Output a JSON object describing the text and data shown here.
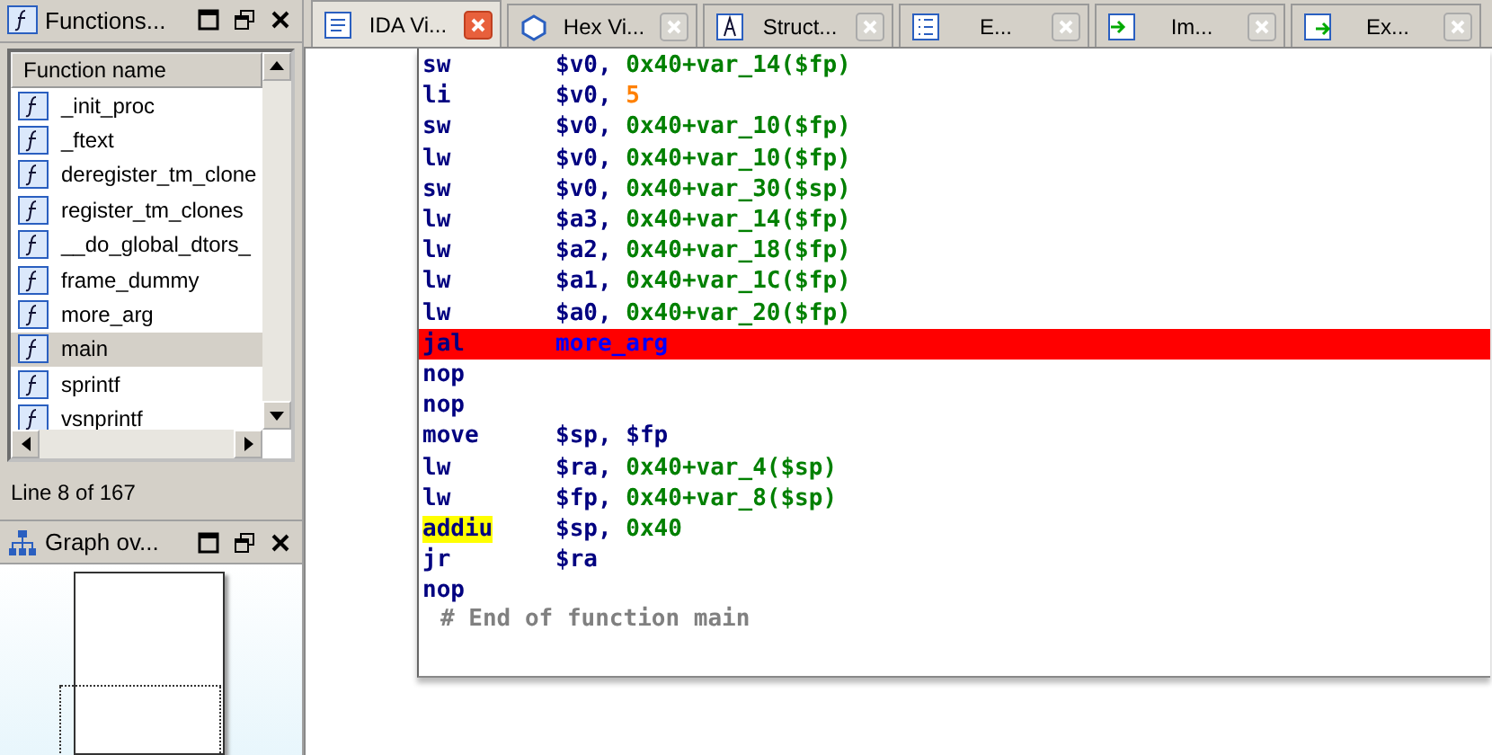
{
  "functions_panel": {
    "title": "Functions...",
    "column": "Function name",
    "items": [
      {
        "name": "_init_proc",
        "selected": false
      },
      {
        "name": "_ftext",
        "selected": false
      },
      {
        "name": "deregister_tm_clone",
        "selected": false
      },
      {
        "name": "register_tm_clones",
        "selected": false
      },
      {
        "name": "__do_global_dtors_",
        "selected": false
      },
      {
        "name": "frame_dummy",
        "selected": false
      },
      {
        "name": "more_arg",
        "selected": false
      },
      {
        "name": "main",
        "selected": true
      },
      {
        "name": "sprintf",
        "selected": false
      },
      {
        "name": "vsnprintf",
        "selected": false
      }
    ],
    "status": "Line 8 of 167"
  },
  "graph_panel": {
    "title": "Graph ov..."
  },
  "tabs": [
    {
      "label": "IDA Vi...",
      "selected": true
    },
    {
      "label": "Hex Vi...",
      "selected": false
    },
    {
      "label": "Struct...",
      "selected": false
    },
    {
      "label": "E...",
      "selected": false
    },
    {
      "label": "Im...",
      "selected": false
    },
    {
      "label": "Ex...",
      "selected": false
    }
  ],
  "listing": {
    "lines": [
      {
        "mnemonic": "sw",
        "selected": false,
        "highlighted": false,
        "operands": [
          {
            "kind": "reg",
            "text": "$v0, "
          },
          {
            "kind": "mem",
            "text": "0x40+var_14($fp)"
          }
        ]
      },
      {
        "mnemonic": "li",
        "selected": false,
        "highlighted": false,
        "operands": [
          {
            "kind": "reg",
            "text": "$v0, "
          },
          {
            "kind": "num",
            "text": "5"
          }
        ]
      },
      {
        "mnemonic": "sw",
        "selected": false,
        "highlighted": false,
        "operands": [
          {
            "kind": "reg",
            "text": "$v0, "
          },
          {
            "kind": "mem",
            "text": "0x40+var_10($fp)"
          }
        ]
      },
      {
        "mnemonic": "lw",
        "selected": false,
        "highlighted": false,
        "operands": [
          {
            "kind": "reg",
            "text": "$v0, "
          },
          {
            "kind": "mem",
            "text": "0x40+var_10($fp)"
          }
        ]
      },
      {
        "mnemonic": "sw",
        "selected": false,
        "highlighted": false,
        "operands": [
          {
            "kind": "reg",
            "text": "$v0, "
          },
          {
            "kind": "mem",
            "text": "0x40+var_30($sp)"
          }
        ]
      },
      {
        "mnemonic": "lw",
        "selected": false,
        "highlighted": false,
        "operands": [
          {
            "kind": "reg",
            "text": "$a3, "
          },
          {
            "kind": "mem",
            "text": "0x40+var_14($fp)"
          }
        ]
      },
      {
        "mnemonic": "lw",
        "selected": false,
        "highlighted": false,
        "operands": [
          {
            "kind": "reg",
            "text": "$a2, "
          },
          {
            "kind": "mem",
            "text": "0x40+var_18($fp)"
          }
        ]
      },
      {
        "mnemonic": "lw",
        "selected": false,
        "highlighted": false,
        "operands": [
          {
            "kind": "reg",
            "text": "$a1, "
          },
          {
            "kind": "mem",
            "text": "0x40+var_1C($fp)"
          }
        ]
      },
      {
        "mnemonic": "lw",
        "selected": false,
        "highlighted": false,
        "operands": [
          {
            "kind": "reg",
            "text": "$a0, "
          },
          {
            "kind": "mem",
            "text": "0x40+var_20($fp)"
          }
        ]
      },
      {
        "mnemonic": "jal",
        "selected": true,
        "highlighted": false,
        "operands": [
          {
            "kind": "name",
            "text": "more_arg"
          }
        ]
      },
      {
        "mnemonic": "nop",
        "selected": false,
        "highlighted": false
      },
      {
        "mnemonic": "nop",
        "selected": false,
        "highlighted": false
      },
      {
        "mnemonic": "move",
        "selected": false,
        "highlighted": false,
        "operands": [
          {
            "kind": "reg",
            "text": "$sp, $fp"
          }
        ]
      },
      {
        "mnemonic": "lw",
        "selected": false,
        "highlighted": false,
        "operands": [
          {
            "kind": "reg",
            "text": "$ra, "
          },
          {
            "kind": "mem",
            "text": "0x40+var_4($sp)"
          }
        ]
      },
      {
        "mnemonic": "lw",
        "selected": false,
        "highlighted": false,
        "operands": [
          {
            "kind": "reg",
            "text": "$fp, "
          },
          {
            "kind": "mem",
            "text": "0x40+var_8($sp)"
          }
        ]
      },
      {
        "mnemonic": "addiu",
        "selected": false,
        "highlighted": true,
        "operands": [
          {
            "kind": "reg",
            "text": "$sp, "
          },
          {
            "kind": "mem",
            "text": "0x40"
          }
        ]
      },
      {
        "mnemonic": "jr",
        "selected": false,
        "highlighted": false,
        "operands": [
          {
            "kind": "reg",
            "text": "$ra"
          }
        ]
      },
      {
        "mnemonic": "nop",
        "selected": false,
        "highlighted": false
      }
    ],
    "comment": "# End of function main"
  }
}
